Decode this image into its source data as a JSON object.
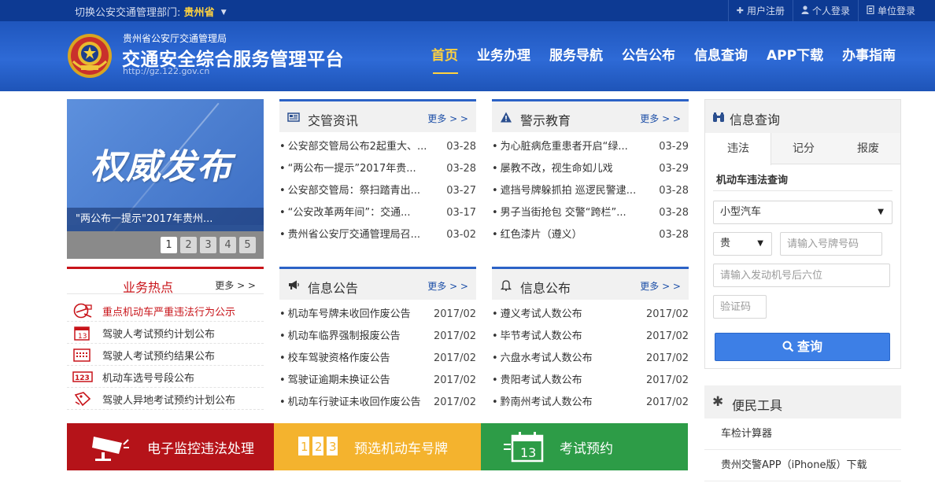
{
  "topbar": {
    "switch_label": "切换公安交通管理部门:",
    "switch_value": "贵州省",
    "links": [
      "用户注册",
      "个人登录",
      "单位登录"
    ]
  },
  "header": {
    "org": "贵州省公安厅交通管理局",
    "title": "交通安全综合服务管理平台",
    "url": "http://gz.122.gov.cn",
    "nav": [
      "首页",
      "业务办理",
      "服务导航",
      "公告公布",
      "信息查询",
      "APP下载",
      "办事指南"
    ]
  },
  "slider": {
    "hero_text": "权威发布",
    "caption": "\"两公布一提示\"2017年贵州...",
    "pages": [
      "1",
      "2",
      "3",
      "4",
      "5"
    ]
  },
  "panels": {
    "jgzx": {
      "title": "交管资讯",
      "more": "更多 > >",
      "items": [
        {
          "title": "公安部交管局公布2起重大、...",
          "date": "03-28"
        },
        {
          "title": "“两公布一提示”2017年贵...",
          "date": "03-28"
        },
        {
          "title": "公安部交管局：祭扫踏青出...",
          "date": "03-27"
        },
        {
          "title": "“公安改革两年间”：交通...",
          "date": "03-17"
        },
        {
          "title": "贵州省公安厅交通管理局召...",
          "date": "03-02"
        }
      ]
    },
    "jsjy": {
      "title": "警示教育",
      "more": "更多 > >",
      "items": [
        {
          "title": "为心脏病危重患者开启“绿...",
          "date": "03-29"
        },
        {
          "title": "屡教不改，视生命如儿戏",
          "date": "03-29"
        },
        {
          "title": "遮挡号牌躲抓拍 巡逻民警逮...",
          "date": "03-28"
        },
        {
          "title": "男子当街抢包 交警“跨栏”...",
          "date": "03-28"
        },
        {
          "title": "红色漆片（遵义）",
          "date": "03-28"
        }
      ]
    },
    "xxgg": {
      "title": "信息公告",
      "more": "更多 > >",
      "items": [
        {
          "title": "机动车号牌未收回作废公告",
          "date": "2017/02"
        },
        {
          "title": "机动车临界强制报废公告",
          "date": "2017/02"
        },
        {
          "title": "校车驾驶资格作废公告",
          "date": "2017/02"
        },
        {
          "title": "驾驶证逾期未换证公告",
          "date": "2017/02"
        },
        {
          "title": "机动车行驶证未收回作废公告",
          "date": "2017/02"
        }
      ]
    },
    "xxgb": {
      "title": "信息公布",
      "more": "更多 > >",
      "items": [
        {
          "title": "遵义考试人数公布",
          "date": "2017/02"
        },
        {
          "title": "毕节考试人数公布",
          "date": "2017/02"
        },
        {
          "title": "六盘水考试人数公布",
          "date": "2017/02"
        },
        {
          "title": "贵阳考试人数公布",
          "date": "2017/02"
        },
        {
          "title": "黔南州考试人数公布",
          "date": "2017/02"
        }
      ]
    }
  },
  "hot": {
    "title": "业务热点",
    "more": "更多 > >",
    "items": [
      {
        "label": "重点机动车严重违法行为公示",
        "icon": "warning-car-icon"
      },
      {
        "label": "驾驶人考试预约计划公布",
        "icon": "calendar-13-icon"
      },
      {
        "label": "驾驶人考试预约结果公布",
        "icon": "calendar-grid-icon"
      },
      {
        "label": "机动车选号号段公布",
        "icon": "number-123-icon"
      },
      {
        "label": "驾驶人异地考试预约计划公布",
        "icon": "tag-icon"
      }
    ]
  },
  "query": {
    "title": "信息查询",
    "tabs": [
      "违法",
      "记分",
      "报废"
    ],
    "subtitle": "机动车违法查询",
    "vehicle_type": "小型汽车",
    "province": "贵",
    "plate_placeholder": "请输入号牌号码",
    "engine_placeholder": "请输入发动机号后六位",
    "captcha_placeholder": "验证码",
    "button": "查询"
  },
  "tools": {
    "title": "便民工具",
    "items": [
      "车检计算器",
      "贵州交警APP（iPhone版）下载"
    ]
  },
  "banners": [
    "电子监控违法处理",
    "预选机动车号牌",
    "考试预约"
  ],
  "banner_icons": {
    "b1_digits": "",
    "b2_digits": [
      "1",
      "2",
      "3"
    ],
    "b3_day": "13"
  },
  "colors": {
    "brand_blue": "#2b62c6",
    "hot_red": "#c8141a",
    "accent_yellow": "#ffd23f",
    "banner_red": "#b51319",
    "banner_yellow": "#f4b32e",
    "banner_green": "#2d9c47",
    "button_blue": "#3d7fe6"
  }
}
